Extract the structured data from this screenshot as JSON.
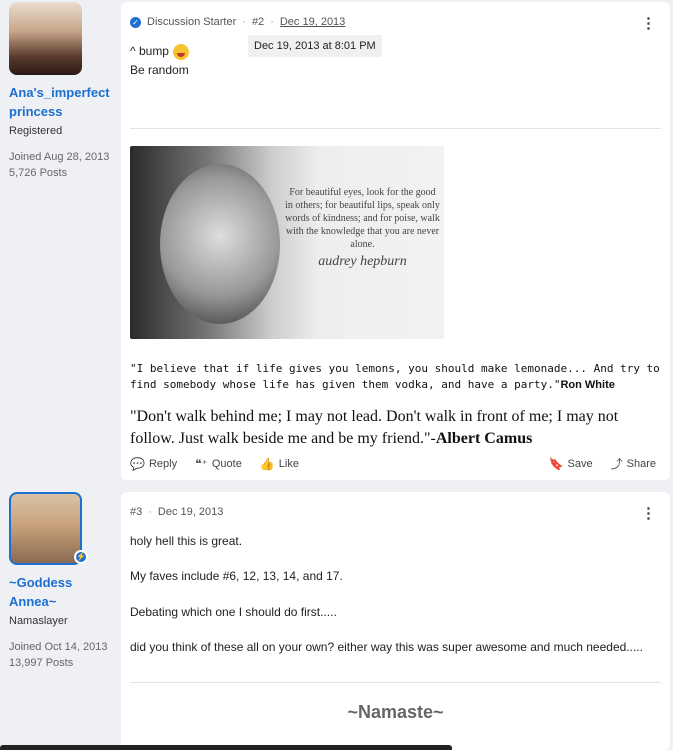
{
  "colors": {
    "link": "#1d6fd0",
    "page_bg": "#eef0f4"
  },
  "posts": [
    {
      "author": {
        "name": "Ana's_imperfect princess",
        "role": "Registered",
        "joined": "Joined Aug 28, 2013",
        "posts": "5,726 Posts"
      },
      "starter_label": "Discussion Starter",
      "number": "#2",
      "date": "Dec 19, 2013",
      "tooltip": "Dec 19, 2013 at 8:01 PM",
      "lines": [
        "^ bump",
        "Be random"
      ],
      "image_quote": "For beautiful eyes, look for the good in others; for beautiful lips, speak only words of kindness; and for poise, walk with the knowledge that you are never alone.",
      "image_signature": "audrey hepburn",
      "lemons_text": "\"I believe that if life gives you lemons, you should make lemonade... And try to find somebody whose life has given them vodka, and have a party.\"",
      "lemons_author": "Ron White",
      "camus_text": "\"Don't walk behind me; I may not lead. Don't walk in front of me; I may not follow. Just walk beside me and be my friend.\"-",
      "camus_author": "Albert Camus",
      "actions": {
        "reply": "Reply",
        "quote": "Quote",
        "like": "Like",
        "save": "Save",
        "share": "Share"
      }
    },
    {
      "author": {
        "name": "~Goddess Annea~",
        "role": "Namaslayer",
        "joined": "Joined Oct 14, 2013",
        "posts": "13,997 Posts"
      },
      "number": "#3",
      "date": "Dec 19, 2013",
      "lines": [
        "holy hell this is great.",
        "My faves include #6, 12, 13, 14, and 17.",
        "Debating which one I should do first.....",
        "did you think of these all on your own? either way this was super awesome and much needed....."
      ],
      "signature": "~Namaste~"
    }
  ]
}
